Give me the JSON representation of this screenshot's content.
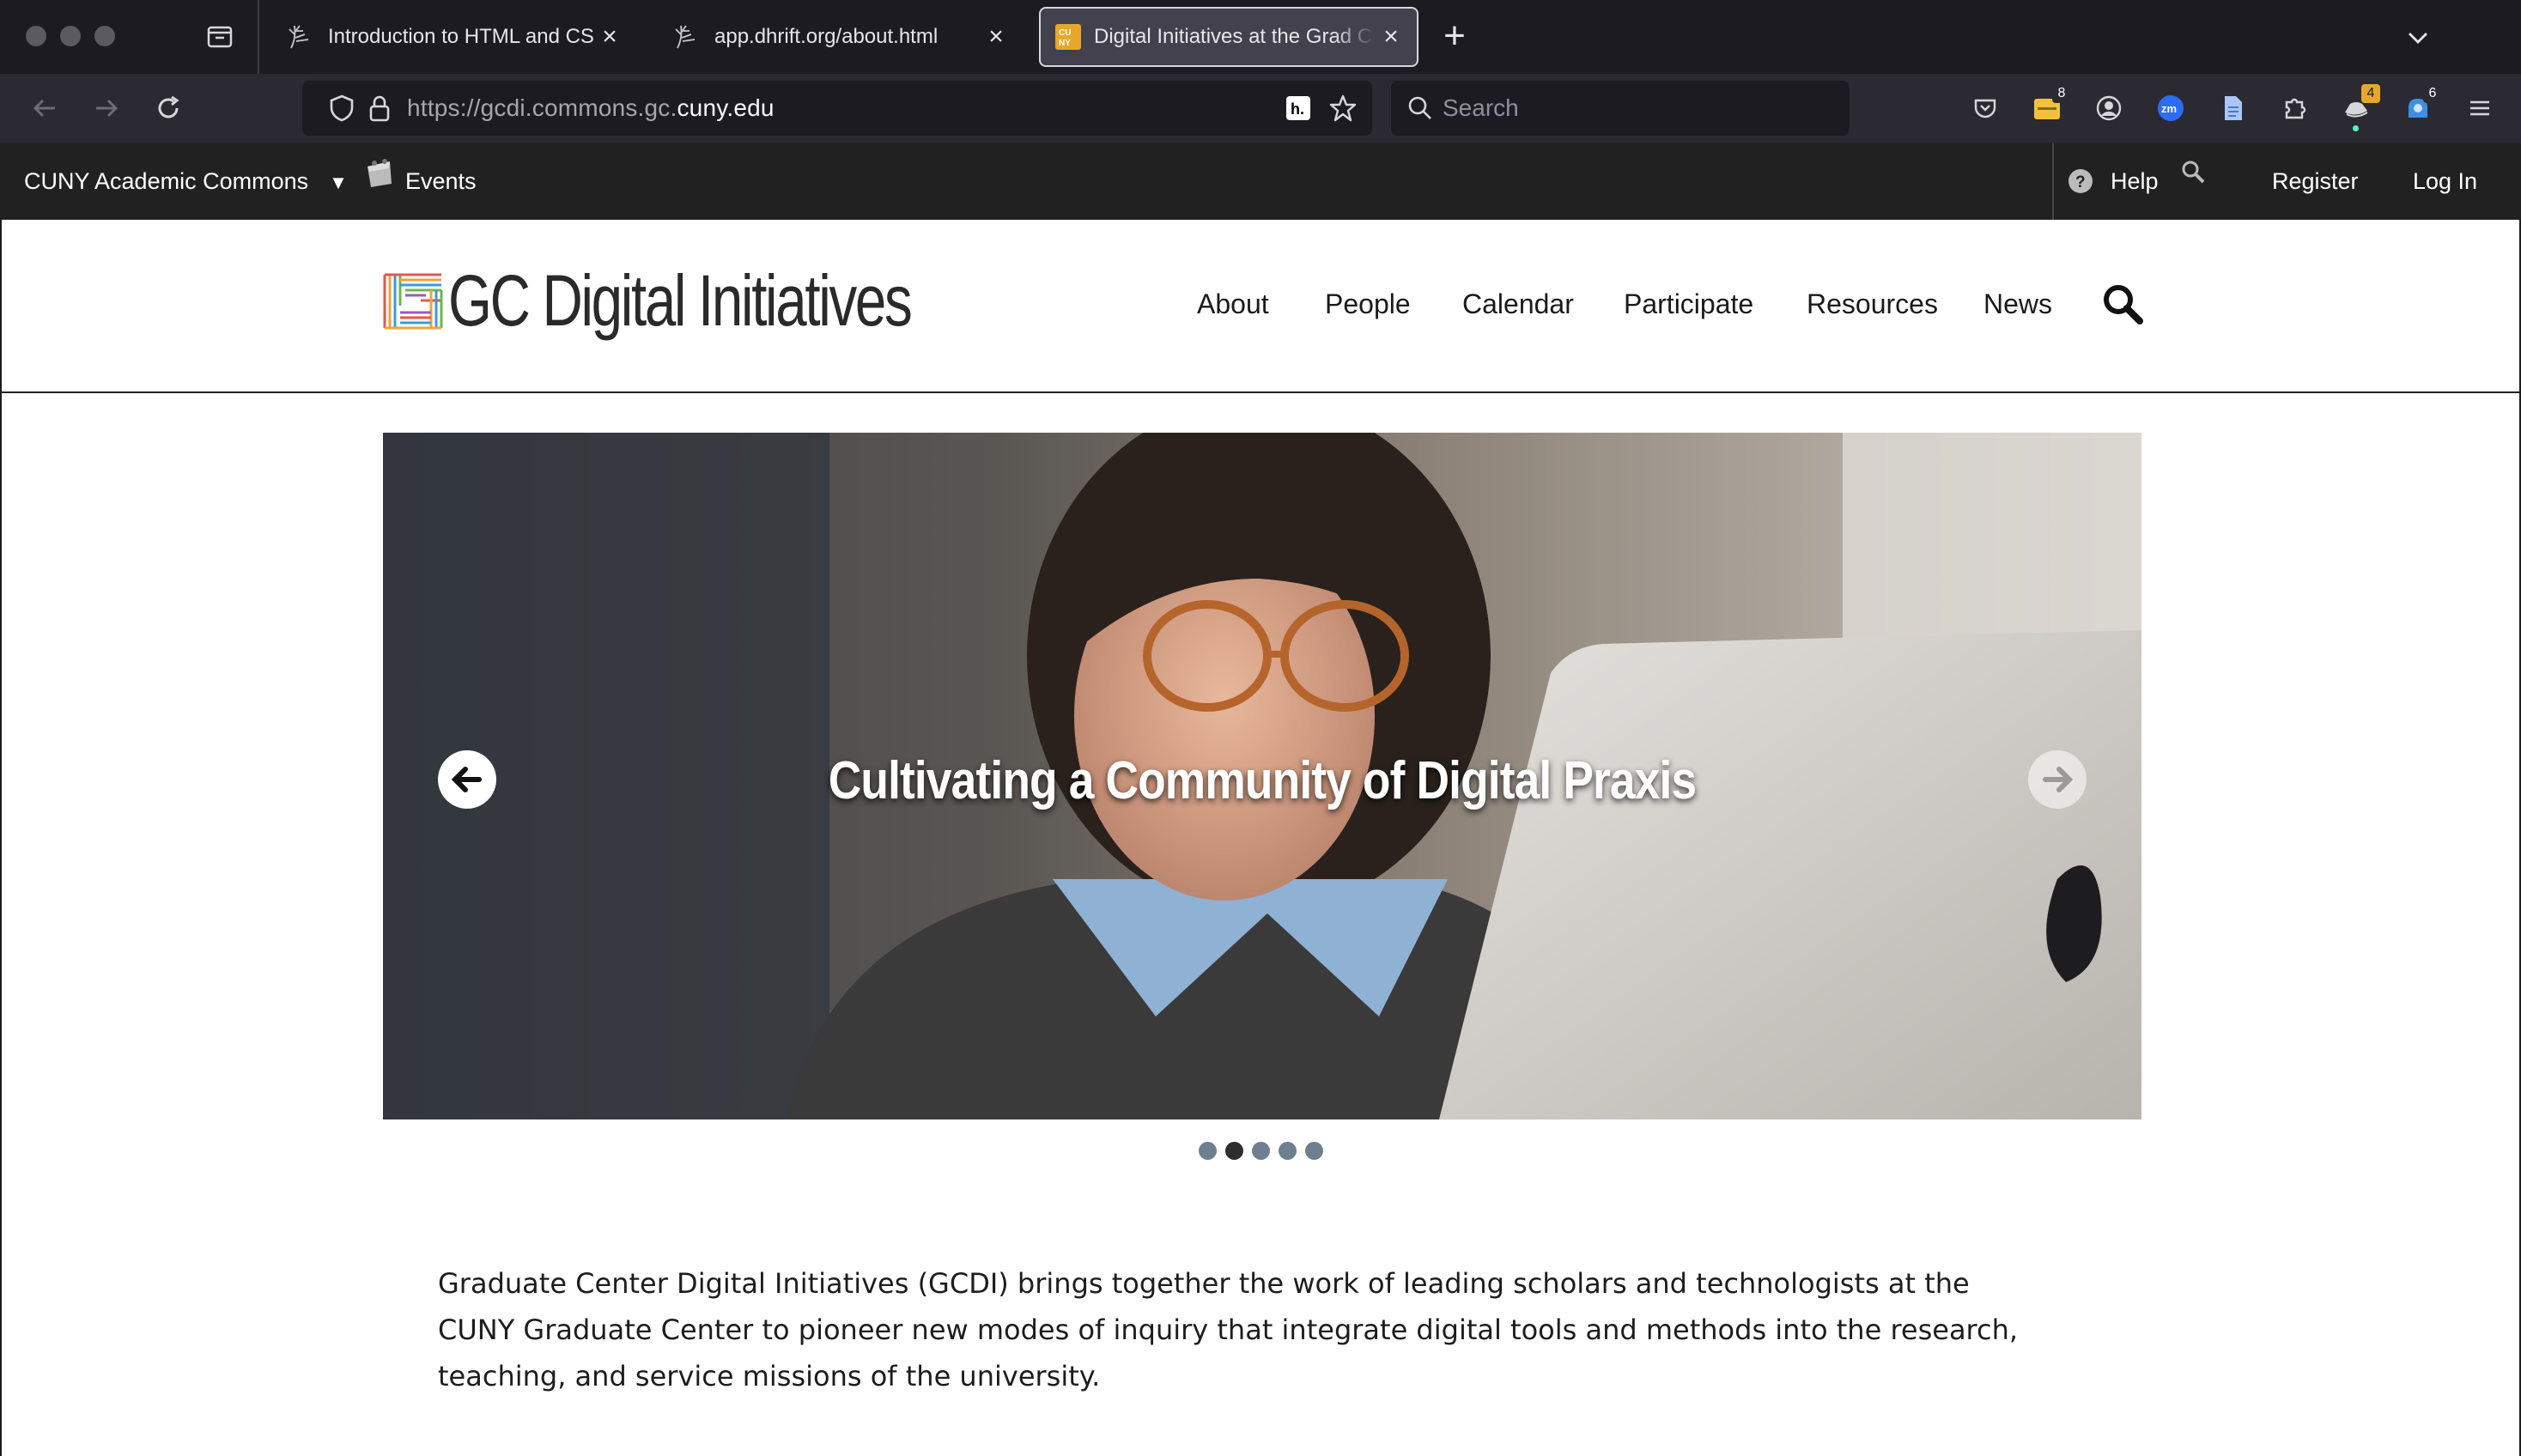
{
  "browser": {
    "tabs": [
      {
        "title": "Introduction to HTML and CSS",
        "favicon": "dandelion-icon"
      },
      {
        "title": "app.dhrift.org/about.html",
        "favicon": "dandelion-icon"
      },
      {
        "title": "Digital Initiatives at the Grad Center",
        "favicon": "cuny-icon",
        "active": true
      }
    ],
    "url_prefix": "https://gcdi.commons.gc.",
    "url_host": "cuny.edu",
    "search_placeholder": "Search",
    "extensions": [
      {
        "name": "pocket-icon"
      },
      {
        "name": "folder-extension-icon",
        "badge": "8"
      },
      {
        "name": "account-icon"
      },
      {
        "name": "zoom-icon",
        "label": "zm"
      },
      {
        "name": "document-icon"
      },
      {
        "name": "extensions-puzzle-icon"
      },
      {
        "name": "hat-extension-icon",
        "badge": "4"
      },
      {
        "name": "notification-extension-icon",
        "badge": "6"
      }
    ],
    "colors": {
      "accent_badge": "#e8a72b",
      "zoom_blue": "#2d6cf5"
    }
  },
  "adminbar": {
    "site_name": "CUNY Academic Commons",
    "events": "Events",
    "help": "Help",
    "register": "Register",
    "login": "Log In"
  },
  "site": {
    "logo": "GC Digital Initiatives",
    "nav": [
      "About",
      "People",
      "Calendar",
      "Participate",
      "Resources",
      "News"
    ]
  },
  "carousel": {
    "caption": "Cultivating a Community of Digital Praxis",
    "slide_count": 5,
    "active_slide": 2
  },
  "intro": "Graduate Center Digital Initiatives (GCDI) brings together the work of leading scholars and technologists at the CUNY Graduate Center to pioneer new modes of inquiry that integrate digital tools and methods into the research, teaching, and service missions of the university."
}
